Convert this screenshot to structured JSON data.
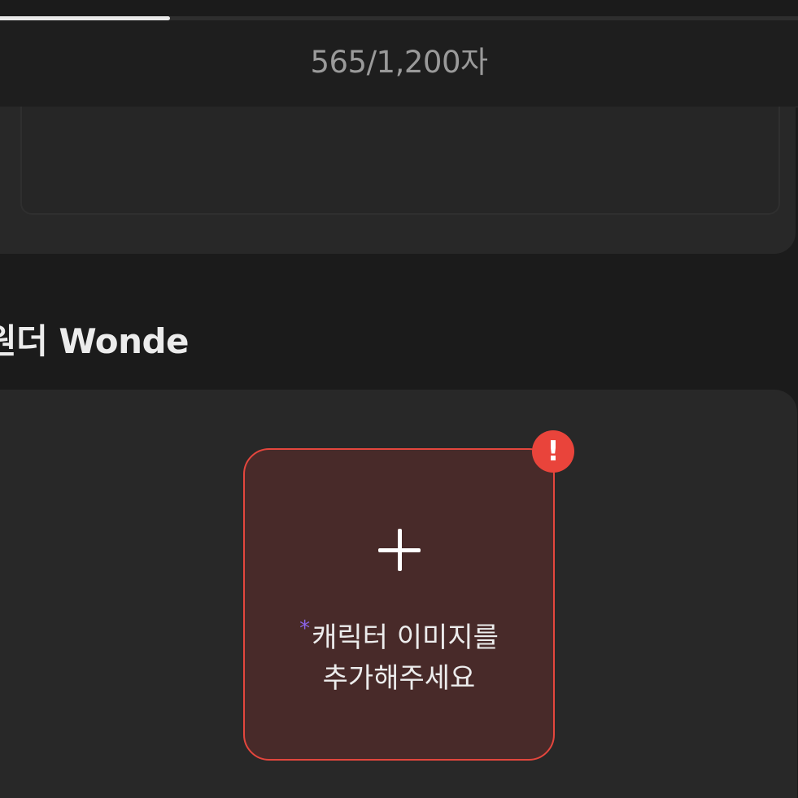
{
  "progress": {
    "fraction": 0.213
  },
  "editor": {
    "char_count": "565/1,200자"
  },
  "section": {
    "title": "원더 Wonde"
  },
  "image_upload": {
    "required_mark": "*",
    "line1": "캐릭터 이미지를",
    "line2": "추가해주세요",
    "error_symbol": "!"
  },
  "icons": {
    "add": "plus-icon",
    "error": "exclamation-icon"
  },
  "colors": {
    "background": "#1b1b1b",
    "card": "#282828",
    "error": "#e9443b",
    "upload_fill": "#482a29",
    "required_accent": "#8a63e8"
  }
}
